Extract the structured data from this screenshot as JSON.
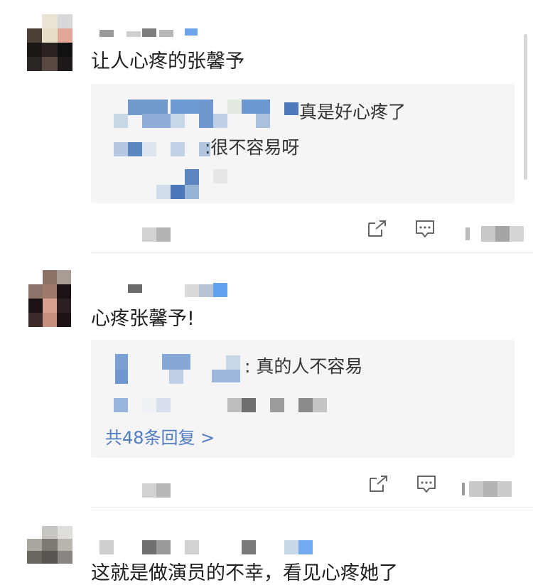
{
  "comments": [
    {
      "text": "让人心疼的张馨予",
      "replies": [
        {
          "text": "真是好心疼了"
        },
        {
          "text": ":很不容易呀"
        }
      ]
    },
    {
      "text": "心疼张馨予!",
      "replies": [
        {
          "text": ": 真的人不容易"
        }
      ],
      "more_replies": "共48条回复 >"
    },
    {
      "text": "这就是做演员的不幸，看见心疼她了"
    }
  ],
  "icons": {
    "share": "share-icon",
    "reply": "comment-icon",
    "like": "like-icon"
  },
  "colors": {
    "link": "#4f7cc4",
    "reply_bg": "#f5f5f5"
  }
}
